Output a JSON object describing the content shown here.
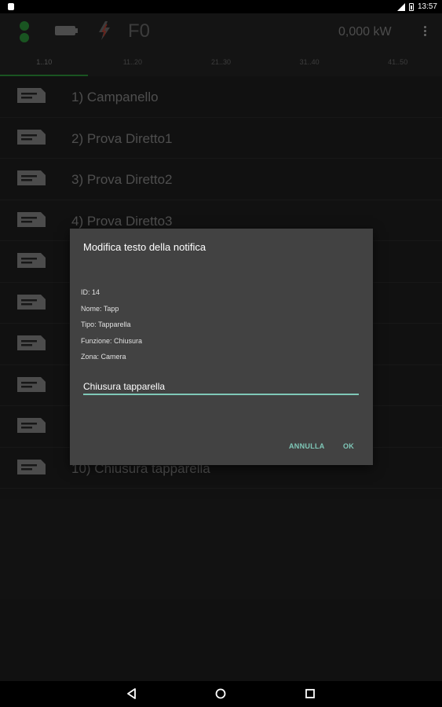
{
  "statusbar": {
    "time": "13:57"
  },
  "appbar": {
    "title": "F0",
    "power": "0,000 kW"
  },
  "tabs": [
    {
      "label": "1..10"
    },
    {
      "label": "11..20"
    },
    {
      "label": "21..30"
    },
    {
      "label": "31..40"
    },
    {
      "label": "41..50"
    }
  ],
  "list": [
    {
      "label": "1) Campanello"
    },
    {
      "label": "2) Prova Diretto1"
    },
    {
      "label": "3) Prova Diretto2"
    },
    {
      "label": "4) Prova Diretto3"
    },
    {
      "label": ""
    },
    {
      "label": ""
    },
    {
      "label": ""
    },
    {
      "label": ""
    },
    {
      "label": ""
    },
    {
      "label": "10) Chiusura tapparella"
    }
  ],
  "dialog": {
    "title": "Modifica testo della notifica",
    "id": "ID: 14",
    "nome": "Nome: Tapp",
    "tipo": "Tipo: Tapparella",
    "funzione": "Funzione: Chiusura",
    "zona": "Zona: Camera",
    "text_value": "Chiusura tapparella",
    "cancel_label": "ANNULLA",
    "ok_label": "OK"
  },
  "colors": {
    "accent": "#2e9a3c",
    "dialog_accent": "#7fc8b8",
    "background": "#202020"
  },
  "icons": {
    "status_left": "notification-icon",
    "message": "message-icon",
    "battery": "battery-icon",
    "bolt": "lightning-bolt-icon",
    "more": "more-vert-icon",
    "back": "back-icon",
    "home": "home-icon",
    "recents": "recents-icon"
  }
}
